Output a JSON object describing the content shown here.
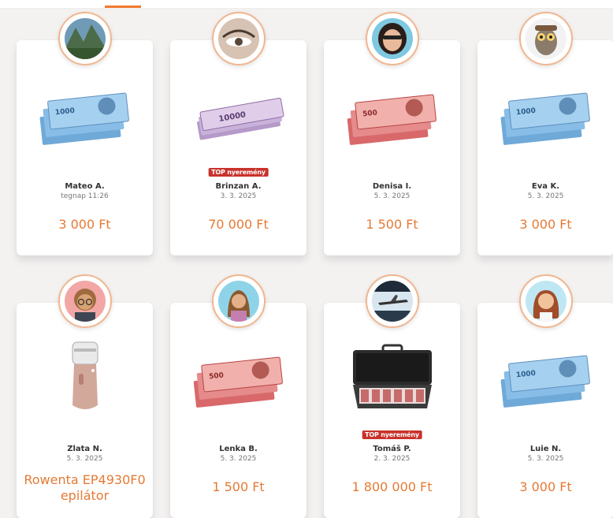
{
  "badges": {
    "top": "TOP nyeremény"
  },
  "cards": [
    {
      "name": "Mateo A.",
      "date": "tegnap 11:26",
      "amount": "3 000 Ft",
      "prize_icon": "banknotes-1000-icon",
      "avatar_icon": "landscape-avatar-icon"
    },
    {
      "name": "Brinzan A.",
      "date": "3. 3. 2025",
      "amount": "70 000 Ft",
      "prize_icon": "banknotes-10000-icon",
      "avatar_icon": "eye-avatar-icon"
    },
    {
      "name": "Denisa I.",
      "date": "5. 3. 2025",
      "amount": "1 500 Ft",
      "prize_icon": "banknotes-500-icon",
      "avatar_icon": "woman-avatar-icon"
    },
    {
      "name": "Eva K.",
      "date": "5. 3. 2025",
      "amount": "3 000 Ft",
      "prize_icon": "banknotes-1000-icon",
      "avatar_icon": "owl-avatar-icon"
    },
    {
      "name": "Zlata N.",
      "date": "5. 3. 2025",
      "amount": "Rowenta EP4930F0 epilátor",
      "prize_icon": "epilator-icon",
      "avatar_icon": "cartoon-woman-glasses-avatar-icon"
    },
    {
      "name": "Lenka B.",
      "date": "5. 3. 2025",
      "amount": "1 500 Ft",
      "prize_icon": "banknotes-500-icon",
      "avatar_icon": "cartoon-woman-avatar-icon"
    },
    {
      "name": "Tomáš P.",
      "date": "2. 3. 2025",
      "amount": "1 800 000 Ft",
      "prize_icon": "money-briefcase-icon",
      "avatar_icon": "airplane-avatar-icon"
    },
    {
      "name": "Luie N.",
      "date": "5. 3. 2025",
      "amount": "3 000 Ft",
      "prize_icon": "banknotes-1000-icon",
      "avatar_icon": "cartoon-girl-avatar-icon"
    }
  ],
  "colors": {
    "accent": "#e57a35",
    "badge": "#c8322b",
    "avatar_ring": "#f1b68f"
  }
}
